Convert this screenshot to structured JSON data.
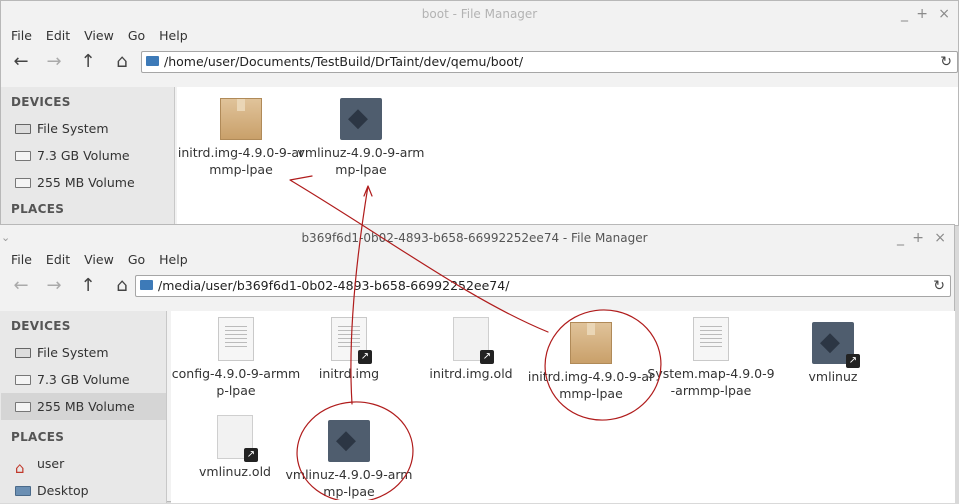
{
  "top_window": {
    "title": "boot - File Manager",
    "controls": [
      "_",
      "+",
      "×"
    ],
    "menu": [
      "File",
      "Edit",
      "View",
      "Go",
      "Help"
    ],
    "path": "/home/user/Documents/TestBuild/DrTaint/dev/qemu/boot/",
    "sidebar": {
      "devices_header": "DEVICES",
      "devices": [
        "File System",
        "7.3 GB Volume",
        "255 MB Volume"
      ],
      "places_header": "PLACES"
    },
    "files": [
      {
        "name": "initrd.img-4.9.0-9-armmp-lpae",
        "icon": "package-icon"
      },
      {
        "name": "vmlinuz-4.9.0-9-armmp-lpae",
        "icon": "binary-icon"
      }
    ]
  },
  "bottom_window": {
    "title": "b369f6d1-0b02-4893-b658-66992252ee74 - File Manager",
    "controls": [
      "_",
      "+",
      "×"
    ],
    "menu": [
      "File",
      "Edit",
      "View",
      "Go",
      "Help"
    ],
    "path": "/media/user/b369f6d1-0b02-4893-b658-66992252ee74/",
    "sidebar": {
      "devices_header": "DEVICES",
      "devices": [
        "File System",
        "7.3 GB Volume",
        "255 MB Volume"
      ],
      "places_header": "PLACES",
      "places": [
        "user",
        "Desktop"
      ]
    },
    "files": [
      {
        "name": "config-4.9.0-9-armmp-lpae",
        "icon": "text-file-icon"
      },
      {
        "name": "initrd.img",
        "icon": "text-file-icon"
      },
      {
        "name": "initrd.img.old",
        "icon": "blank-file-icon"
      },
      {
        "name": "initrd.img-4.9.0-9-armmp-lpae",
        "icon": "package-icon"
      },
      {
        "name": "System.map-4.9.0-9-armmp-lpae",
        "icon": "text-file-icon"
      },
      {
        "name": "vmlinuz",
        "icon": "binary-icon"
      },
      {
        "name": "vmlinuz.old",
        "icon": "blank-file-icon"
      },
      {
        "name": "vmlinuz-4.9.0-9-armmp-lpae",
        "icon": "binary-icon"
      }
    ]
  },
  "colors": {
    "annotation_ink": "#b01c1c",
    "folder_icon": "#3d7ab8"
  }
}
